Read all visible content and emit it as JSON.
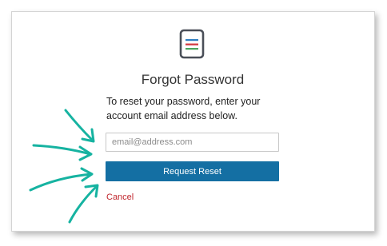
{
  "form": {
    "title": "Forgot Password",
    "instruction": "To reset your password, enter your account email address below.",
    "email_placeholder": "email@address.com",
    "email_value": "",
    "submit_label": "Request Reset",
    "cancel_label": "Cancel"
  },
  "logo": {
    "icon": "document-list-icon",
    "stripe_colors": [
      "#2f7fc1",
      "#d2383f",
      "#4ba65e"
    ]
  },
  "annotations": {
    "icon": "arrow-icon",
    "color": "#16b3a1",
    "count": 4
  },
  "colors": {
    "primary_button": "#146fa3",
    "cancel_link": "#c0262d"
  }
}
